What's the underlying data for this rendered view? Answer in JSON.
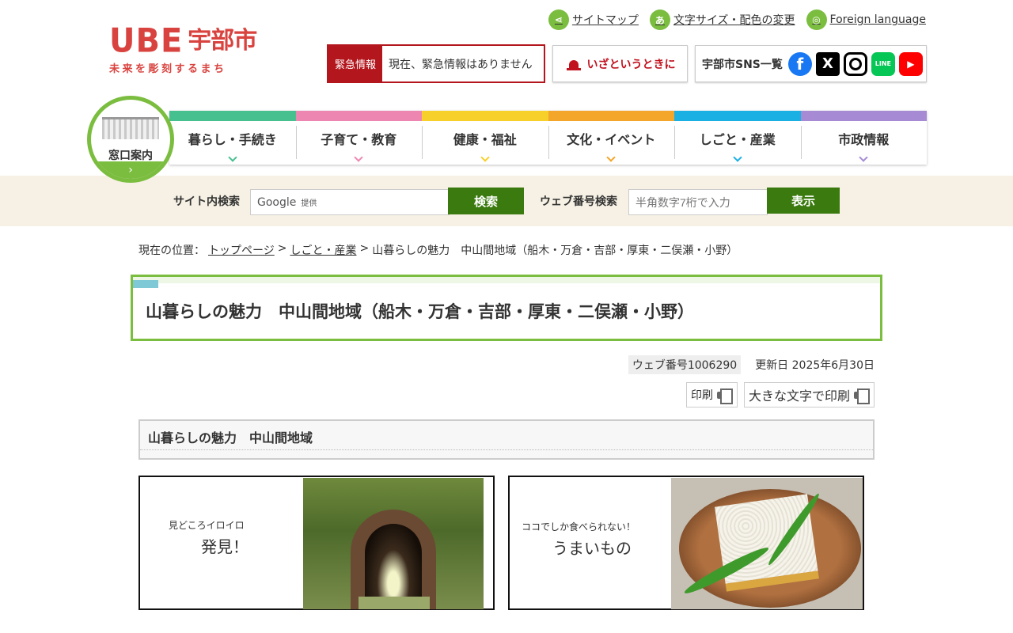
{
  "header": {
    "logo": {
      "main": "UBE",
      "city": "宇部市",
      "tagline": "未来を彫刻するまち"
    },
    "utility_links": [
      {
        "label": "サイトマップ",
        "icon": "share-icon"
      },
      {
        "label": "文字サイズ・配色の変更",
        "icon": "text-size-icon"
      },
      {
        "label": "Foreign language",
        "icon": "globe-icon"
      }
    ],
    "emergency": {
      "label": "緊急情報",
      "text": "現在、緊急情報はありません"
    },
    "izato": {
      "label": "いざというときに",
      "icon": "siren-icon"
    },
    "sns": {
      "label": "宇部市SNS一覧",
      "items": [
        "facebook-icon",
        "x-icon",
        "instagram-icon",
        "line-icon",
        "youtube-icon"
      ]
    }
  },
  "madoguchi": {
    "label": "窓口案内",
    "arrow": "›"
  },
  "gnav": [
    {
      "label": "暮らし・手続き",
      "color": "#47c08f"
    },
    {
      "label": "子育て・教育",
      "color": "#ee86b2"
    },
    {
      "label": "健康・福祉",
      "color": "#f7d02a"
    },
    {
      "label": "文化・イベント",
      "color": "#f4a62a"
    },
    {
      "label": "しごと・産業",
      "color": "#1bb0e4"
    },
    {
      "label": "市政情報",
      "color": "#a68bd4"
    }
  ],
  "search": {
    "site_label": "サイト内検索",
    "google": "Google",
    "google_sub": "提供",
    "search_button": "検索",
    "web_no_label": "ウェブ番号検索",
    "web_no_placeholder": "半角数字7桁で入力",
    "web_no_button": "表示"
  },
  "breadcrumb": {
    "prefix": "現在の位置：",
    "links": [
      "トップページ",
      "しごと・産業"
    ],
    "current": "山暮らしの魅力　中山間地域（船木・万倉・吉部・厚東・二俣瀬・小野）"
  },
  "page": {
    "title": "山暮らしの魅力　中山間地域（船木・万倉・吉部・厚東・二俣瀬・小野）",
    "web_number": "ウェブ番号1006290",
    "updated": "更新日 2025年6月30日",
    "print": "印刷",
    "print_large": "大きな文字で印刷",
    "section_heading": "山暮らしの魅力　中山間地域"
  },
  "cards": [
    {
      "small": "見どころイロイロ",
      "big": "発見！"
    },
    {
      "small": "ココでしか食べられない！",
      "big": "うまいもの"
    }
  ]
}
